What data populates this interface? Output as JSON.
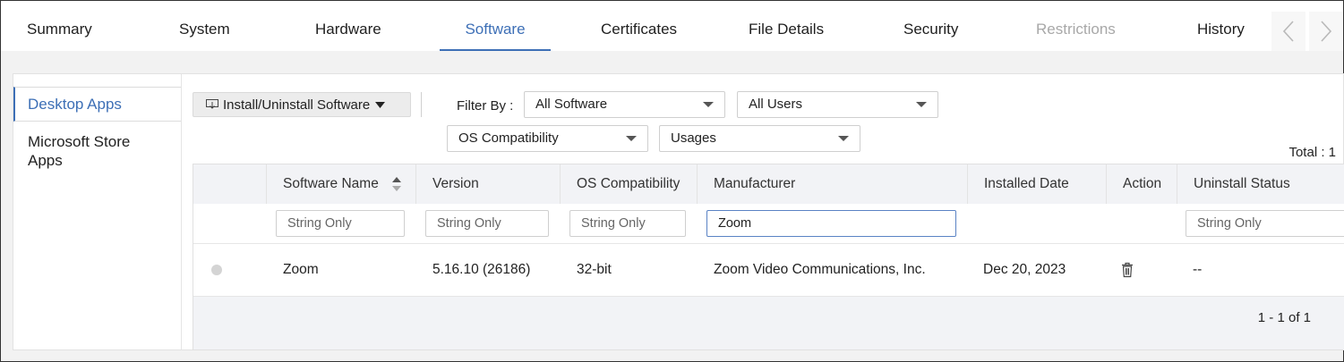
{
  "tabs": [
    {
      "label": "Summary",
      "state": "normal"
    },
    {
      "label": "System",
      "state": "normal"
    },
    {
      "label": "Hardware",
      "state": "normal"
    },
    {
      "label": "Software",
      "state": "active"
    },
    {
      "label": "Certificates",
      "state": "normal"
    },
    {
      "label": "File Details",
      "state": "normal"
    },
    {
      "label": "Security",
      "state": "normal"
    },
    {
      "label": "Restrictions",
      "state": "disabled"
    },
    {
      "label": "History",
      "state": "normal"
    }
  ],
  "sidebar": {
    "items": [
      {
        "label": "Desktop Apps",
        "active": true
      },
      {
        "label": "Microsoft Store Apps",
        "active": false
      }
    ]
  },
  "toolbar": {
    "install_label": "Install/Uninstall Software",
    "filter_by_label": "Filter By :",
    "filters": {
      "software": "All Software",
      "users": "All Users",
      "os_compat": "OS Compatibility",
      "usages": "Usages"
    },
    "total": "Total : 1"
  },
  "table": {
    "columns": [
      "Software Name",
      "Version",
      "OS Compatibility",
      "Manufacturer",
      "Installed Date",
      "Action",
      "Uninstall Status"
    ],
    "filter_placeholder": "String Only",
    "manufacturer_filter_value": "Zoom",
    "rows": [
      {
        "name": "Zoom",
        "version": "5.16.10 (26186)",
        "os_compat": "32-bit",
        "manufacturer": "Zoom Video Communications, Inc.",
        "installed_date": "Dec 20, 2023",
        "action_icon": "trash-icon",
        "uninstall_status": "--"
      }
    ],
    "pagination": "1 - 1 of 1"
  },
  "colors": {
    "accent": "#3d6fb6",
    "disabled": "#a8a8a8",
    "header_bg": "#f2f3f6"
  }
}
